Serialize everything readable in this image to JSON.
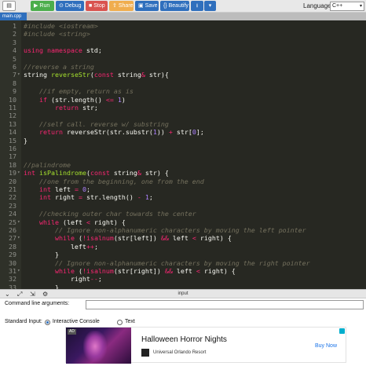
{
  "toolbar": {
    "menu_icon": "folder-icon",
    "run_label": "Run",
    "debug_label": "Debug",
    "stop_label": "Stop",
    "share_label": "Share",
    "save_label": "Save",
    "beautify_label": "{} Beautify",
    "download_icon": "download-icon",
    "caret_icon": "chevron-down-icon"
  },
  "language": {
    "label": "Language",
    "selected": "C++"
  },
  "tabs": [
    {
      "label": "main.cpp"
    }
  ],
  "code_lines": [
    {
      "n": "1",
      "html": "<span class=\"cm\">#include &lt;iostream&gt;</span>"
    },
    {
      "n": "2",
      "html": "<span class=\"cm\">#include &lt;string&gt;</span>"
    },
    {
      "n": "3",
      "html": ""
    },
    {
      "n": "4",
      "html": "<span class=\"kw\">using namespace</span> std;"
    },
    {
      "n": "5",
      "html": ""
    },
    {
      "n": "6",
      "html": "<span class=\"cm\">//reverse a string</span>"
    },
    {
      "n": "7",
      "fold": true,
      "html": "string <span class=\"fn\">reverseStr</span>(<span class=\"kw\">const</span> string<span class=\"op\">&amp;</span> str){"
    },
    {
      "n": "8",
      "html": ""
    },
    {
      "n": "9",
      "html": "    <span class=\"cm\">//if empty, return as is</span>"
    },
    {
      "n": "10",
      "html": "    <span class=\"kw\">if</span> (str.length() <span class=\"op\">&lt;=</span> <span class=\"num\">1</span>)"
    },
    {
      "n": "11",
      "html": "        <span class=\"kw\">return</span> str;"
    },
    {
      "n": "12",
      "html": ""
    },
    {
      "n": "13",
      "html": "    <span class=\"cm\">//self call. reverse w/ substring</span>"
    },
    {
      "n": "14",
      "html": "    <span class=\"kw\">return</span> reverseStr(str.substr(<span class=\"num\">1</span>)) <span class=\"op\">+</span> str[<span class=\"num\">0</span>];"
    },
    {
      "n": "15",
      "html": "}"
    },
    {
      "n": "16",
      "html": ""
    },
    {
      "n": "17",
      "html": ""
    },
    {
      "n": "18",
      "html": "<span class=\"cm\">//palindrome</span>"
    },
    {
      "n": "19",
      "fold": true,
      "html": "<span class=\"kw\">int</span> <span class=\"fn\">isPalindrome</span>(<span class=\"kw\">const</span> string<span class=\"op\">&amp;</span> str) {"
    },
    {
      "n": "20",
      "html": "    <span class=\"cm\">//one from the beginning, one from the end</span>"
    },
    {
      "n": "21",
      "html": "    <span class=\"kw\">int</span> left <span class=\"op\">=</span> <span class=\"num\">0</span>;"
    },
    {
      "n": "22",
      "html": "    <span class=\"kw\">int</span> right <span class=\"op\">=</span> str.length() <span class=\"op\">-</span> <span class=\"num\">1</span>;"
    },
    {
      "n": "23",
      "html": ""
    },
    {
      "n": "24",
      "html": "    <span class=\"cm\">//checking outer char towards the center</span>"
    },
    {
      "n": "25",
      "fold": true,
      "html": "    <span class=\"kw\">while</span> (left <span class=\"op\">&lt;</span> right) {"
    },
    {
      "n": "26",
      "html": "        <span class=\"cm\">// Ignore non-alphanumeric characters by moving the left pointer</span>"
    },
    {
      "n": "27",
      "fold": true,
      "html": "        <span class=\"kw\">while</span> (<span class=\"op\">!</span><span class=\"kw\">isalnum</span>(str[left]) <span class=\"op\">&amp;&amp;</span> left <span class=\"op\">&lt;</span> right) {"
    },
    {
      "n": "28",
      "html": "            left<span class=\"op\">++</span>;"
    },
    {
      "n": "29",
      "html": "        }"
    },
    {
      "n": "30",
      "html": "        <span class=\"cm\">// Ignore non-alphanumeric characters by moving the right pointer</span>"
    },
    {
      "n": "31",
      "fold": true,
      "html": "        <span class=\"kw\">while</span> (<span class=\"op\">!</span><span class=\"kw\">isalnum</span>(str[right]) <span class=\"op\">&amp;&amp;</span> left <span class=\"op\">&lt;</span> right) {"
    },
    {
      "n": "32",
      "html": "            right<span class=\"op\">--</span>;"
    },
    {
      "n": "33",
      "html": "        }"
    }
  ],
  "panel": {
    "title": "input",
    "icons": [
      "chevron-down-icon",
      "expand-icon",
      "wrap-icon",
      "gear-icon"
    ]
  },
  "input": {
    "cla_label": "Command line arguments:",
    "cla_value": "",
    "stdin_label": "Standard Input:",
    "interactive_label": "Interactive Console",
    "text_label": "Text",
    "selected": "interactive"
  },
  "ad": {
    "tag": "AD",
    "title": "Halloween Horror Nights",
    "sponsor": "Universal Orlando Resort",
    "cta": "Buy Now"
  }
}
